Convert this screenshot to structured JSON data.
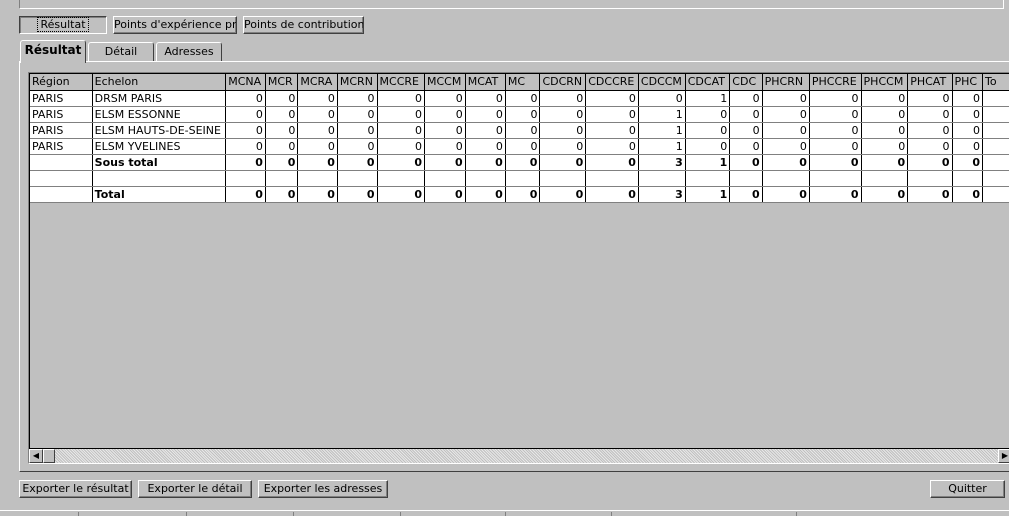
{
  "top_buttons": {
    "resultat": "Résultat",
    "points_experience": "Points d'expérience pro",
    "points_contribution": "Points de contribution"
  },
  "tabs": [
    "Résultat",
    "Détail",
    "Adresses"
  ],
  "grid": {
    "columns": [
      "Région",
      "Echelon",
      "MCNA",
      "MCR",
      "MCRA",
      "MCRN",
      "MCCRE",
      "MCCM",
      "MCAT",
      "MC",
      "CDCRN",
      "CDCCRE",
      "CDCCM",
      "CDCAT",
      "CDC",
      "PHCRN",
      "PHCCRE",
      "PHCCM",
      "PHCAT",
      "PHC",
      "To"
    ],
    "rows": [
      {
        "region": "PARIS",
        "echelon": "DRSM PARIS",
        "values": [
          "0",
          "0",
          "0",
          "0",
          "0",
          "0",
          "0",
          "0",
          "0",
          "0",
          "0",
          "1",
          "0",
          "0",
          "0",
          "0",
          "0",
          "0"
        ]
      },
      {
        "region": "PARIS",
        "echelon": "ELSM ESSONNE",
        "values": [
          "0",
          "0",
          "0",
          "0",
          "0",
          "0",
          "0",
          "0",
          "0",
          "0",
          "1",
          "0",
          "0",
          "0",
          "0",
          "0",
          "0",
          "0"
        ]
      },
      {
        "region": "PARIS",
        "echelon": "ELSM HAUTS-DE-SEINE",
        "values": [
          "0",
          "0",
          "0",
          "0",
          "0",
          "0",
          "0",
          "0",
          "0",
          "0",
          "1",
          "0",
          "0",
          "0",
          "0",
          "0",
          "0",
          "0"
        ]
      },
      {
        "region": "PARIS",
        "echelon": "ELSM YVELINES",
        "values": [
          "0",
          "0",
          "0",
          "0",
          "0",
          "0",
          "0",
          "0",
          "0",
          "0",
          "1",
          "0",
          "0",
          "0",
          "0",
          "0",
          "0",
          "0"
        ]
      }
    ],
    "subtotal": {
      "label": "Sous total",
      "values": [
        "0",
        "0",
        "0",
        "0",
        "0",
        "0",
        "0",
        "0",
        "0",
        "0",
        "3",
        "1",
        "0",
        "0",
        "0",
        "0",
        "0",
        "0"
      ]
    },
    "total": {
      "label": "Total",
      "values": [
        "0",
        "0",
        "0",
        "0",
        "0",
        "0",
        "0",
        "0",
        "0",
        "0",
        "3",
        "1",
        "0",
        "0",
        "0",
        "0",
        "0",
        "0"
      ]
    }
  },
  "bottom_buttons": {
    "export_result": "Exporter le résultat",
    "export_detail": "Exporter le détail",
    "export_addresses": "Exporter les adresses",
    "quit": "Quitter"
  },
  "icons": {
    "scroll_left": "scroll-left-arrow",
    "scroll_right": "scroll-right-arrow"
  }
}
